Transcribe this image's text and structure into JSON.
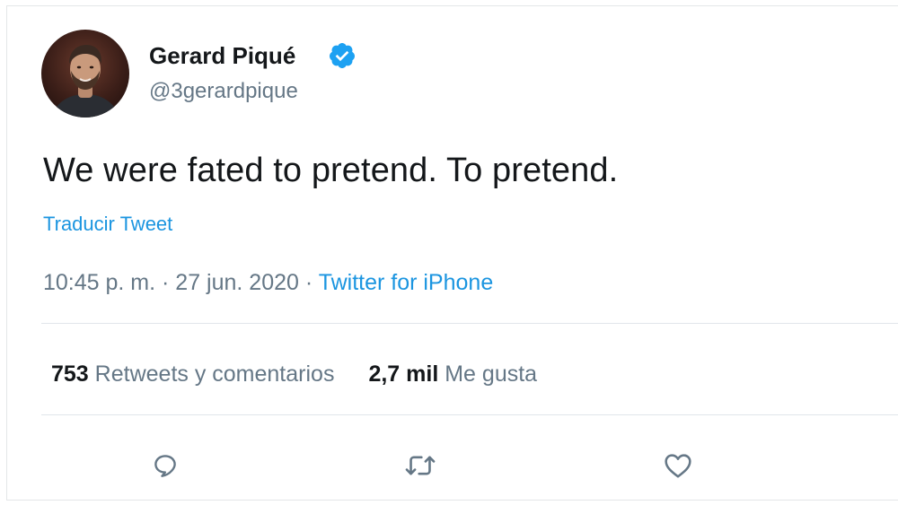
{
  "tweet": {
    "display_name": "Gerard Piqué",
    "handle": "@3gerardpique",
    "verified": true,
    "text": "We were fated to pretend. To pretend.",
    "translate_label": "Traducir Tweet",
    "time": "10:45 p. m.",
    "separator": " · ",
    "date": "27 jun. 2020",
    "source": "Twitter for iPhone"
  },
  "stats": {
    "retweets_count": "753",
    "retweets_label": "Retweets y comentarios",
    "likes_count": "2,7 mil",
    "likes_label": "Me gusta"
  },
  "actions": [
    {
      "name": "reply",
      "icon": "speech-bubble-icon"
    },
    {
      "name": "retweet",
      "icon": "retweet-arrows-icon"
    },
    {
      "name": "like",
      "icon": "heart-icon"
    }
  ],
  "colors": {
    "text_primary": "#14171a",
    "text_secondary": "#657786",
    "link": "#1b95e0",
    "verified_badge": "#1da1f2",
    "divider": "#e1e6ea"
  }
}
